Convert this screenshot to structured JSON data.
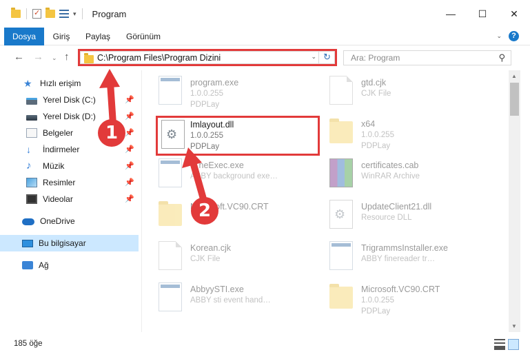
{
  "window": {
    "title": "Program",
    "minimize": "—",
    "maximize": "☐",
    "close": "✕"
  },
  "ribbon": {
    "tabs": [
      "Dosya",
      "Giriş",
      "Paylaş",
      "Görünüm"
    ],
    "expand": "⌄",
    "help": "?"
  },
  "nav": {
    "back": "←",
    "forward": "→",
    "recent": "⌄",
    "up": "↑",
    "address": "C:\\Program Files\\Program Dizini",
    "address_dropdown": "⌄",
    "refresh": "↻",
    "search_placeholder": "Ara: Program",
    "search_icon": "⚲"
  },
  "sidebar": {
    "items": [
      {
        "label": "Hızlı erişim",
        "icon": "star-icon"
      },
      {
        "label": "Yerel Disk (C:)",
        "icon": "drive-icon",
        "pinned": true
      },
      {
        "label": "Yerel Disk (D:)",
        "icon": "drive-icon",
        "pinned": true
      },
      {
        "label": "Belgeler",
        "icon": "documents-icon",
        "pinned": true
      },
      {
        "label": "İndirmeler",
        "icon": "download-icon",
        "pinned": true
      },
      {
        "label": "Müzik",
        "icon": "music-icon",
        "pinned": true
      },
      {
        "label": "Resimler",
        "icon": "pictures-icon",
        "pinned": true
      },
      {
        "label": "Videolar",
        "icon": "video-icon",
        "pinned": true
      },
      {
        "label": "OneDrive",
        "icon": "onedrive-icon"
      },
      {
        "label": "Bu bilgisayar",
        "icon": "computer-icon",
        "selected": true
      },
      {
        "label": "Ağ",
        "icon": "network-icon"
      }
    ],
    "pin_glyph": "📌"
  },
  "files": {
    "left": [
      {
        "name": "program.exe",
        "line1": "1.0.0.255",
        "line2": "PDPLay"
      },
      {
        "name": "Imlayout.dll",
        "line1": "1.0.0.255",
        "line2": "PDPLay"
      },
      {
        "name": "…neExec.exe",
        "line1": "ABBY background exe…",
        "line2": ""
      },
      {
        "name": "M…osoft.VC90.CRT",
        "line1": "",
        "line2": ""
      },
      {
        "name": "Korean.cjk",
        "line1": "CJK File",
        "line2": ""
      },
      {
        "name": "AbbyySTI.exe",
        "line1": "ABBY sti event hand…",
        "line2": ""
      }
    ],
    "right": [
      {
        "name": "gtd.cjk",
        "line1": "CJK File",
        "line2": ""
      },
      {
        "name": "x64",
        "line1": "1.0.0.255",
        "line2": "PDPLay"
      },
      {
        "name": "certificates.cab",
        "line1": "WinRAR Archive",
        "line2": ""
      },
      {
        "name": "UpdateClient21.dll",
        "line1": "Resource DLL",
        "line2": ""
      },
      {
        "name": "TrigrammsInstaller.exe",
        "line1": "ABBY finereader tr…",
        "line2": ""
      },
      {
        "name": "Microsoft.VC90.CRT",
        "line1": "1.0.0.255",
        "line2": "PDPLay"
      }
    ]
  },
  "status": {
    "count": "185 öğe"
  },
  "annotations": {
    "step1": "1",
    "step2": "2",
    "color": "#e23a3a"
  }
}
